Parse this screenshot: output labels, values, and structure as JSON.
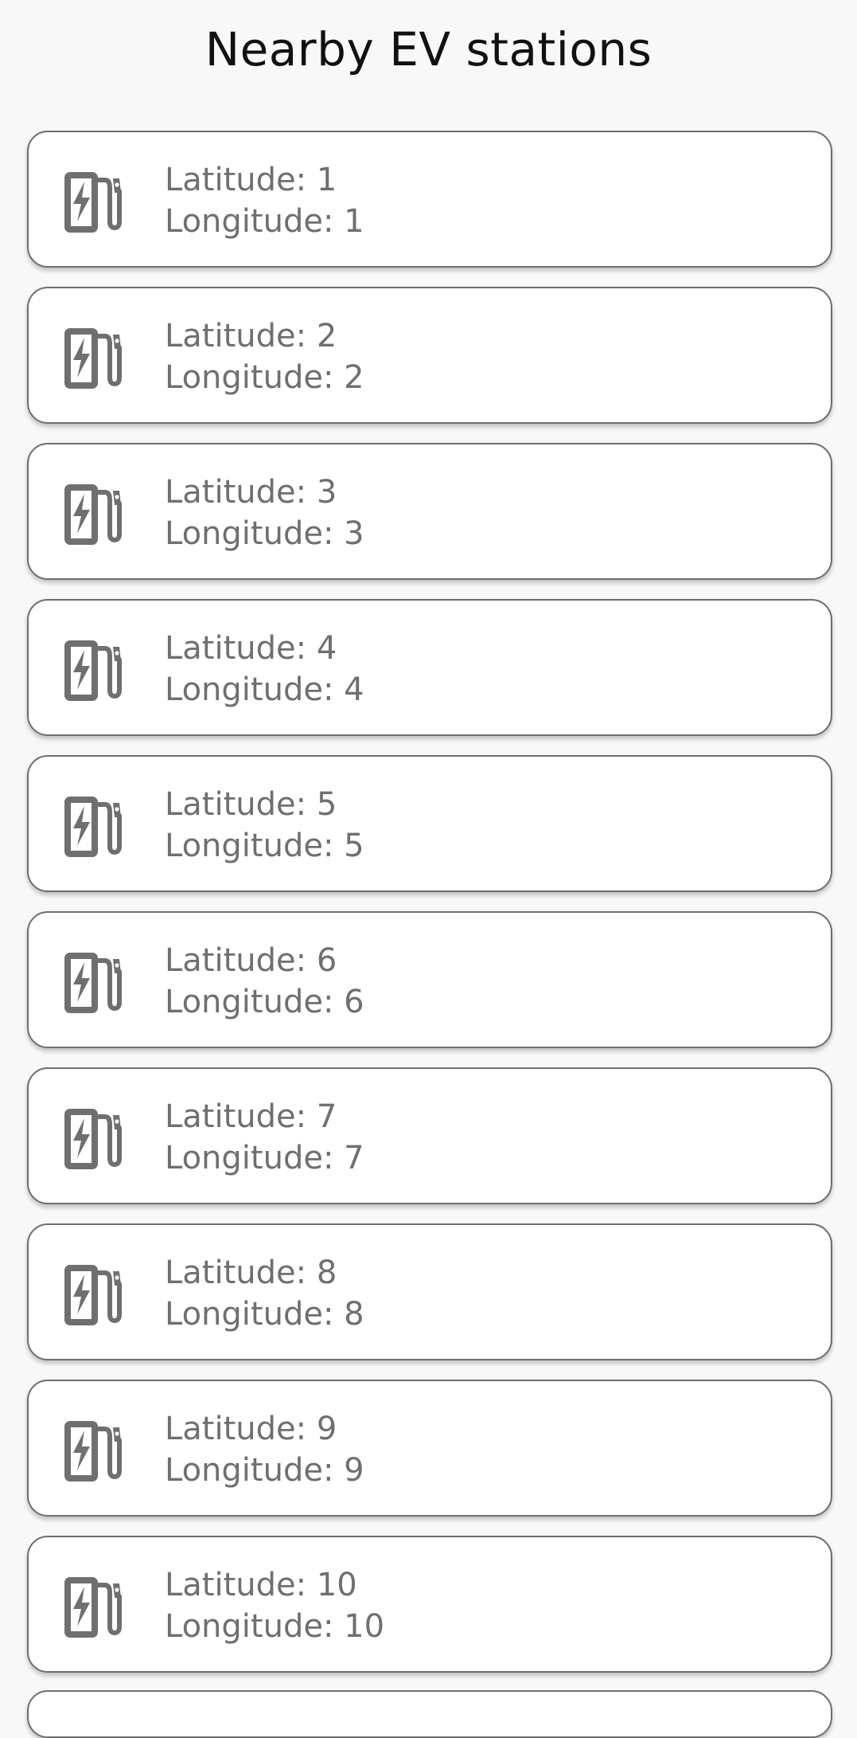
{
  "header": {
    "title": "Nearby EV stations"
  },
  "colors": {
    "background": "#f8f8f8",
    "card_background": "#ffffff",
    "card_border": "#6e6e6e",
    "text": "#6f6f6f",
    "icon": "#6f6f6f"
  },
  "stations": [
    {
      "icon": "ev-station-icon",
      "latitude": "Latitude: 1",
      "longitude": "Longitude: 1"
    },
    {
      "icon": "ev-station-icon",
      "latitude": "Latitude: 2",
      "longitude": "Longitude: 2"
    },
    {
      "icon": "ev-station-icon",
      "latitude": "Latitude: 3",
      "longitude": "Longitude: 3"
    },
    {
      "icon": "ev-station-icon",
      "latitude": "Latitude: 4",
      "longitude": "Longitude: 4"
    },
    {
      "icon": "ev-station-icon",
      "latitude": "Latitude: 5",
      "longitude": "Longitude: 5"
    },
    {
      "icon": "ev-station-icon",
      "latitude": "Latitude: 6",
      "longitude": "Longitude: 6"
    },
    {
      "icon": "ev-station-icon",
      "latitude": "Latitude: 7",
      "longitude": "Longitude: 7"
    },
    {
      "icon": "ev-station-icon",
      "latitude": "Latitude: 8",
      "longitude": "Longitude: 8"
    },
    {
      "icon": "ev-station-icon",
      "latitude": "Latitude: 9",
      "longitude": "Longitude: 9"
    },
    {
      "icon": "ev-station-icon",
      "latitude": "Latitude: 10",
      "longitude": "Longitude: 10"
    }
  ]
}
